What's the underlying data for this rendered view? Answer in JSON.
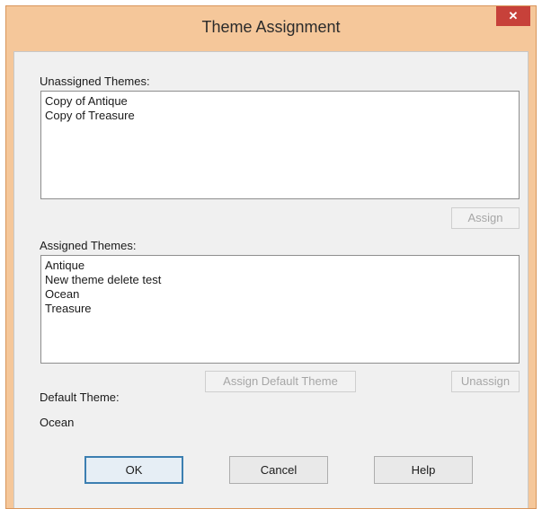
{
  "window": {
    "title": "Theme Assignment",
    "close_glyph": "✕"
  },
  "unassigned": {
    "label": "Unassigned Themes:",
    "items": [
      "Copy of Antique",
      "Copy of Treasure"
    ],
    "assign_label": "Assign"
  },
  "assigned": {
    "label": "Assigned Themes:",
    "items": [
      "Antique",
      "New theme delete test",
      "Ocean",
      "Treasure"
    ],
    "assign_default_label": "Assign Default Theme",
    "unassign_label": "Unassign"
  },
  "default_theme": {
    "label": "Default Theme:",
    "value": "Ocean"
  },
  "buttons": {
    "ok": "OK",
    "cancel": "Cancel",
    "help": "Help"
  },
  "colors": {
    "frame": "#f5c79a",
    "close": "#c7413a",
    "focus": "#3c7fb1"
  }
}
